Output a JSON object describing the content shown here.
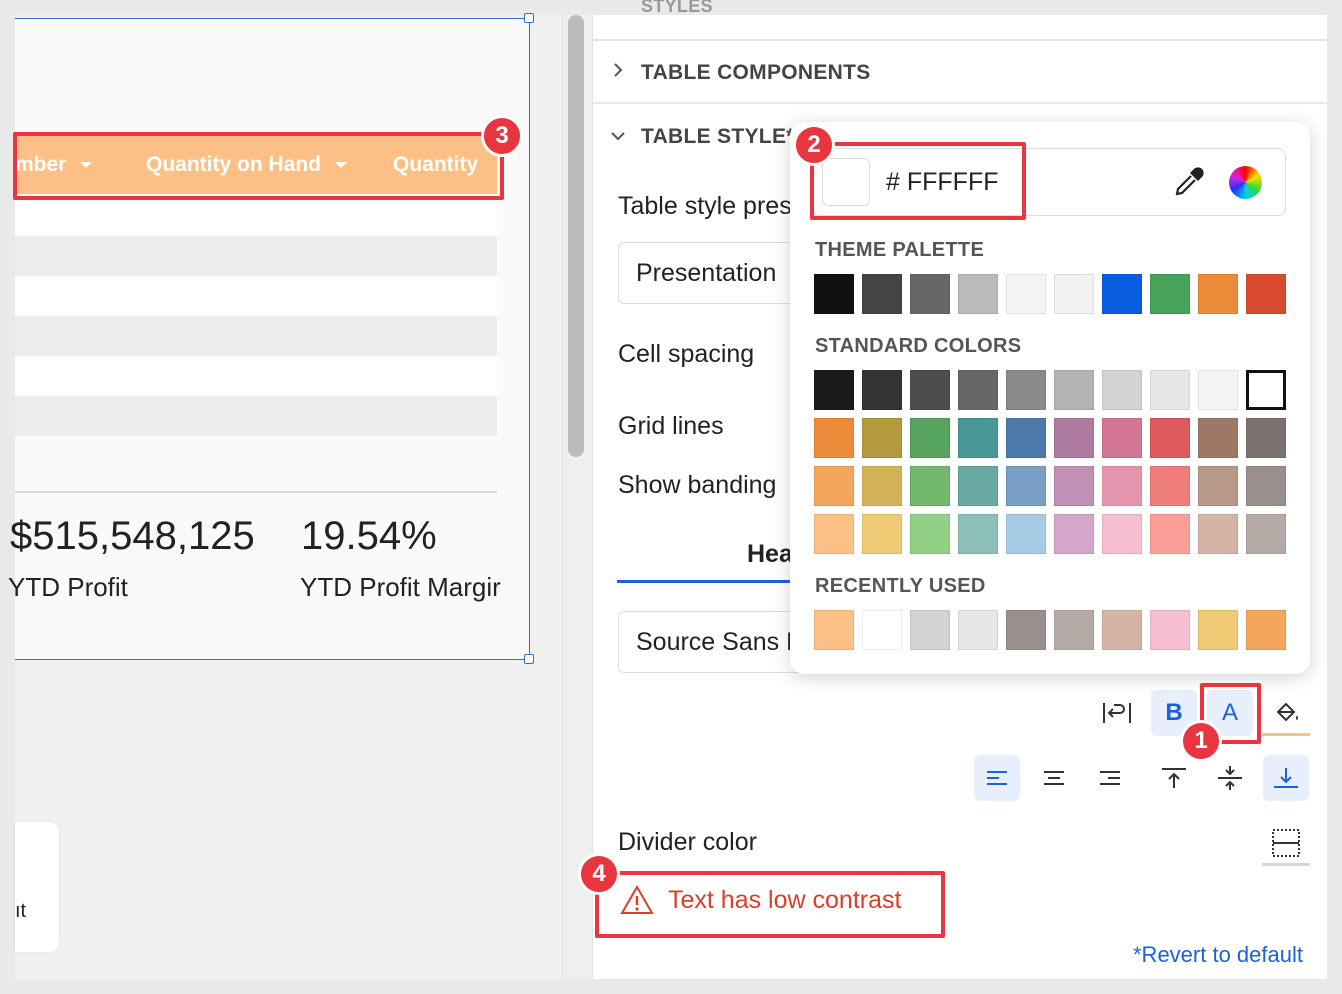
{
  "canvas": {
    "table": {
      "headers": [
        "mber",
        "Quantity on Hand",
        "Quantity"
      ],
      "header_color": "#fcc086",
      "banding_colors": [
        "#ffffff",
        "#ececec"
      ]
    },
    "kpis": [
      {
        "value": "$515,548,125",
        "label": "YTD Profit"
      },
      {
        "value": "19.54%",
        "label": "YTD Profit Margir"
      }
    ],
    "small_card_text": "ıt"
  },
  "panel": {
    "sections": {
      "styles_partial": "STYLES",
      "table_components": "TABLE COMPONENTS",
      "table_style": "TABLE STYLE*"
    },
    "fields": {
      "table_style_preset_label": "Table style pres",
      "table_style_preset_value": "Presentation",
      "cell_spacing_label": "Cell spacing",
      "grid_lines_label": "Grid lines",
      "show_banding_label": "Show banding",
      "tab_header_label": "Hea",
      "font_value": "Source Sans F",
      "divider_color_label": "Divider color"
    },
    "warning_text": "Text has low contrast",
    "revert_label": "*Revert to default",
    "toolbar": {
      "wrap_icon": "wrap-text-icon",
      "bold_label": "B",
      "text_color_label": "A",
      "fill_icon": "fill-bucket-icon",
      "align_icons": [
        "align-left-icon",
        "align-center-icon",
        "align-right-icon",
        "valign-top-icon",
        "valign-middle-icon",
        "valign-bottom-icon"
      ]
    }
  },
  "color_picker": {
    "hex_prefix": "#",
    "hex_value": "FFFFFF",
    "theme_palette_title": "THEME PALETTE",
    "standard_colors_title": "STANDARD COLORS",
    "recently_used_title": "RECENTLY USED",
    "theme_palette": [
      "#111111",
      "#444444",
      "#666666",
      "#bbbbbb",
      "#f5f5f5",
      "#f1f1f1",
      "#0a5ce0",
      "#48a35a",
      "#ec8c3b",
      "#d84b2e"
    ],
    "standard_colors": [
      [
        "#1a1a1a",
        "#333333",
        "#4d4d4d",
        "#666666",
        "#8a8a8a",
        "#b3b3b3",
        "#d3d3d3",
        "#e6e6e6",
        "#f5f5f5",
        "#ffffff"
      ],
      [
        "#ec8c3b",
        "#b39a3c",
        "#57a45e",
        "#4a9896",
        "#4d79a8",
        "#ad7ba0",
        "#d47795",
        "#df5a5e",
        "#9d7866",
        "#7b726f"
      ],
      [
        "#f4a75c",
        "#d2b458",
        "#74b86e",
        "#6aaaa5",
        "#79a0c4",
        "#c191b5",
        "#e596ae",
        "#ee7d7b",
        "#b89887",
        "#9a8f8c"
      ],
      [
        "#fcc086",
        "#eeca74",
        "#92d086",
        "#8cbfba",
        "#a5cbe5",
        "#d4a6cb",
        "#f7bed0",
        "#fb9f98",
        "#d5b4a7",
        "#b5aaa6"
      ]
    ],
    "recently_used": [
      "#fcc086",
      "#ffffff",
      "#d3d3d3",
      "#e6e6e6",
      "#9a8f8c",
      "#b5aaa6",
      "#d5b4a7",
      "#f7bed0",
      "#eeca74",
      "#f4a75c"
    ]
  },
  "annotations": {
    "badge_1": "1",
    "badge_2": "2",
    "badge_3": "3",
    "badge_4": "4",
    "color": "#e8353f"
  }
}
